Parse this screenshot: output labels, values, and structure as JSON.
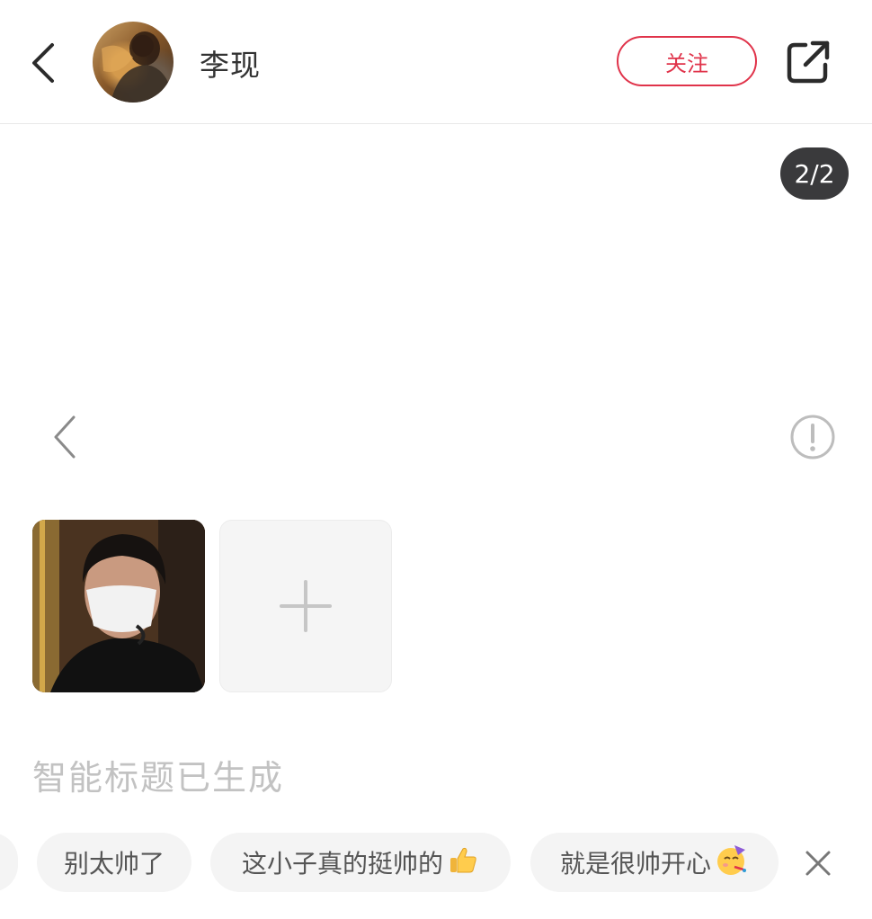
{
  "header": {
    "back_icon": "chevron-left-icon",
    "username": "李现",
    "follow_label": "关注",
    "share_icon": "share-external-icon",
    "accent_color": "#e0334a"
  },
  "viewer": {
    "page_indicator": "2/2",
    "prev_icon": "chevron-left-icon",
    "report_icon": "exclamation-circle-icon"
  },
  "editor": {
    "add_icon": "plus-icon",
    "smart_title": "智能标题已生成",
    "suggestions": [
      {
        "text": "别太帅了",
        "emoji": ""
      },
      {
        "text": "这小子真的挺帅的",
        "emoji": "thumbs-up-icon"
      },
      {
        "text": "就是很帅开心",
        "emoji": "party-face-icon"
      }
    ],
    "close_icon": "close-icon"
  }
}
